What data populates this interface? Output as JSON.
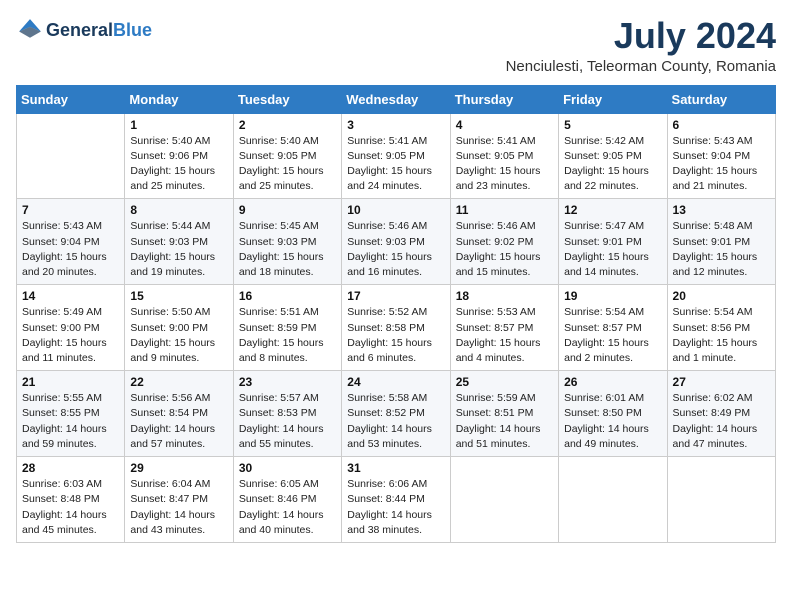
{
  "header": {
    "logo": {
      "general": "General",
      "blue": "Blue"
    },
    "title": "July 2024",
    "location": "Nenciulesti, Teleorman County, Romania"
  },
  "weekdays": [
    "Sunday",
    "Monday",
    "Tuesday",
    "Wednesday",
    "Thursday",
    "Friday",
    "Saturday"
  ],
  "weeks": [
    [
      {
        "day": "",
        "sunrise": "",
        "sunset": "",
        "daylight": ""
      },
      {
        "day": "1",
        "sunrise": "Sunrise: 5:40 AM",
        "sunset": "Sunset: 9:06 PM",
        "daylight": "Daylight: 15 hours and 25 minutes."
      },
      {
        "day": "2",
        "sunrise": "Sunrise: 5:40 AM",
        "sunset": "Sunset: 9:05 PM",
        "daylight": "Daylight: 15 hours and 25 minutes."
      },
      {
        "day": "3",
        "sunrise": "Sunrise: 5:41 AM",
        "sunset": "Sunset: 9:05 PM",
        "daylight": "Daylight: 15 hours and 24 minutes."
      },
      {
        "day": "4",
        "sunrise": "Sunrise: 5:41 AM",
        "sunset": "Sunset: 9:05 PM",
        "daylight": "Daylight: 15 hours and 23 minutes."
      },
      {
        "day": "5",
        "sunrise": "Sunrise: 5:42 AM",
        "sunset": "Sunset: 9:05 PM",
        "daylight": "Daylight: 15 hours and 22 minutes."
      },
      {
        "day": "6",
        "sunrise": "Sunrise: 5:43 AM",
        "sunset": "Sunset: 9:04 PM",
        "daylight": "Daylight: 15 hours and 21 minutes."
      }
    ],
    [
      {
        "day": "7",
        "sunrise": "Sunrise: 5:43 AM",
        "sunset": "Sunset: 9:04 PM",
        "daylight": "Daylight: 15 hours and 20 minutes."
      },
      {
        "day": "8",
        "sunrise": "Sunrise: 5:44 AM",
        "sunset": "Sunset: 9:03 PM",
        "daylight": "Daylight: 15 hours and 19 minutes."
      },
      {
        "day": "9",
        "sunrise": "Sunrise: 5:45 AM",
        "sunset": "Sunset: 9:03 PM",
        "daylight": "Daylight: 15 hours and 18 minutes."
      },
      {
        "day": "10",
        "sunrise": "Sunrise: 5:46 AM",
        "sunset": "Sunset: 9:03 PM",
        "daylight": "Daylight: 15 hours and 16 minutes."
      },
      {
        "day": "11",
        "sunrise": "Sunrise: 5:46 AM",
        "sunset": "Sunset: 9:02 PM",
        "daylight": "Daylight: 15 hours and 15 minutes."
      },
      {
        "day": "12",
        "sunrise": "Sunrise: 5:47 AM",
        "sunset": "Sunset: 9:01 PM",
        "daylight": "Daylight: 15 hours and 14 minutes."
      },
      {
        "day": "13",
        "sunrise": "Sunrise: 5:48 AM",
        "sunset": "Sunset: 9:01 PM",
        "daylight": "Daylight: 15 hours and 12 minutes."
      }
    ],
    [
      {
        "day": "14",
        "sunrise": "Sunrise: 5:49 AM",
        "sunset": "Sunset: 9:00 PM",
        "daylight": "Daylight: 15 hours and 11 minutes."
      },
      {
        "day": "15",
        "sunrise": "Sunrise: 5:50 AM",
        "sunset": "Sunset: 9:00 PM",
        "daylight": "Daylight: 15 hours and 9 minutes."
      },
      {
        "day": "16",
        "sunrise": "Sunrise: 5:51 AM",
        "sunset": "Sunset: 8:59 PM",
        "daylight": "Daylight: 15 hours and 8 minutes."
      },
      {
        "day": "17",
        "sunrise": "Sunrise: 5:52 AM",
        "sunset": "Sunset: 8:58 PM",
        "daylight": "Daylight: 15 hours and 6 minutes."
      },
      {
        "day": "18",
        "sunrise": "Sunrise: 5:53 AM",
        "sunset": "Sunset: 8:57 PM",
        "daylight": "Daylight: 15 hours and 4 minutes."
      },
      {
        "day": "19",
        "sunrise": "Sunrise: 5:54 AM",
        "sunset": "Sunset: 8:57 PM",
        "daylight": "Daylight: 15 hours and 2 minutes."
      },
      {
        "day": "20",
        "sunrise": "Sunrise: 5:54 AM",
        "sunset": "Sunset: 8:56 PM",
        "daylight": "Daylight: 15 hours and 1 minute."
      }
    ],
    [
      {
        "day": "21",
        "sunrise": "Sunrise: 5:55 AM",
        "sunset": "Sunset: 8:55 PM",
        "daylight": "Daylight: 14 hours and 59 minutes."
      },
      {
        "day": "22",
        "sunrise": "Sunrise: 5:56 AM",
        "sunset": "Sunset: 8:54 PM",
        "daylight": "Daylight: 14 hours and 57 minutes."
      },
      {
        "day": "23",
        "sunrise": "Sunrise: 5:57 AM",
        "sunset": "Sunset: 8:53 PM",
        "daylight": "Daylight: 14 hours and 55 minutes."
      },
      {
        "day": "24",
        "sunrise": "Sunrise: 5:58 AM",
        "sunset": "Sunset: 8:52 PM",
        "daylight": "Daylight: 14 hours and 53 minutes."
      },
      {
        "day": "25",
        "sunrise": "Sunrise: 5:59 AM",
        "sunset": "Sunset: 8:51 PM",
        "daylight": "Daylight: 14 hours and 51 minutes."
      },
      {
        "day": "26",
        "sunrise": "Sunrise: 6:01 AM",
        "sunset": "Sunset: 8:50 PM",
        "daylight": "Daylight: 14 hours and 49 minutes."
      },
      {
        "day": "27",
        "sunrise": "Sunrise: 6:02 AM",
        "sunset": "Sunset: 8:49 PM",
        "daylight": "Daylight: 14 hours and 47 minutes."
      }
    ],
    [
      {
        "day": "28",
        "sunrise": "Sunrise: 6:03 AM",
        "sunset": "Sunset: 8:48 PM",
        "daylight": "Daylight: 14 hours and 45 minutes."
      },
      {
        "day": "29",
        "sunrise": "Sunrise: 6:04 AM",
        "sunset": "Sunset: 8:47 PM",
        "daylight": "Daylight: 14 hours and 43 minutes."
      },
      {
        "day": "30",
        "sunrise": "Sunrise: 6:05 AM",
        "sunset": "Sunset: 8:46 PM",
        "daylight": "Daylight: 14 hours and 40 minutes."
      },
      {
        "day": "31",
        "sunrise": "Sunrise: 6:06 AM",
        "sunset": "Sunset: 8:44 PM",
        "daylight": "Daylight: 14 hours and 38 minutes."
      },
      {
        "day": "",
        "sunrise": "",
        "sunset": "",
        "daylight": ""
      },
      {
        "day": "",
        "sunrise": "",
        "sunset": "",
        "daylight": ""
      },
      {
        "day": "",
        "sunrise": "",
        "sunset": "",
        "daylight": ""
      }
    ]
  ]
}
